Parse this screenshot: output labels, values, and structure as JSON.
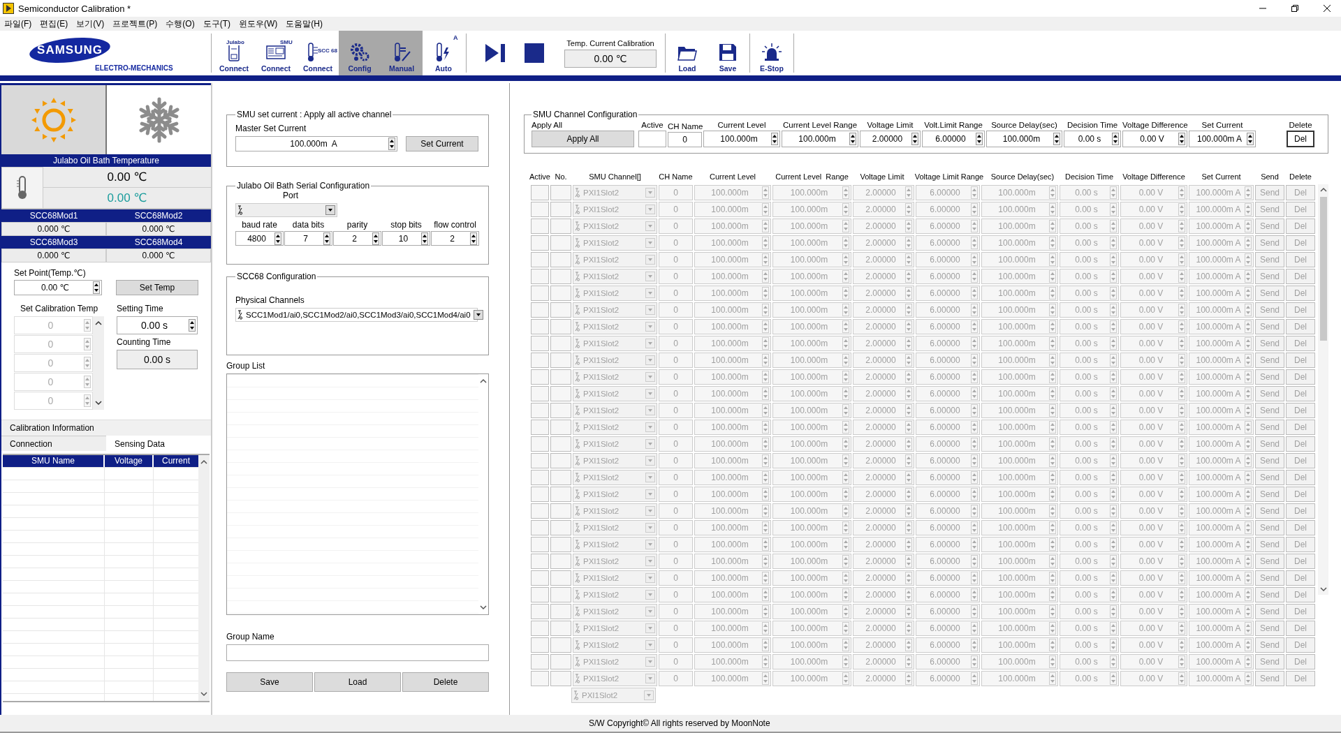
{
  "window": {
    "title": "Semiconductor Calibration *"
  },
  "menu": [
    "파일(F)",
    "편집(E)",
    "보기(V)",
    "프로젝트(P)",
    "수행(O)",
    "도구(T)",
    "윈도우(W)",
    "도움말(H)"
  ],
  "logo": {
    "brand": "SAMSUNG",
    "sub": "ELECTRO-MECHANICS"
  },
  "toolbar": [
    {
      "kind": "julabo",
      "label": "Connect",
      "icon_text": "Julabo",
      "selected": false
    },
    {
      "kind": "smu",
      "label": "Connect",
      "icon_text": "SMU",
      "selected": false
    },
    {
      "kind": "scc",
      "label": "Connect",
      "icon_text": "SCC 68",
      "selected": false
    },
    {
      "kind": "config",
      "label": "Config",
      "selected": true
    },
    {
      "kind": "manual",
      "label": "Manual",
      "selected": true
    },
    {
      "kind": "auto",
      "label": "Auto",
      "icon_text": "A",
      "selected": false
    }
  ],
  "temp_calibration": {
    "label": "Temp. Current Calibration",
    "value": "0.00 ℃"
  },
  "file_buttons": [
    {
      "kind": "load",
      "label": "Load"
    },
    {
      "kind": "save",
      "label": "Save"
    },
    {
      "kind": "estop",
      "label": "E-Stop"
    }
  ],
  "mode_buttons": [
    {
      "kind": "heat",
      "selected": true
    },
    {
      "kind": "cool",
      "selected": false
    }
  ],
  "bath": {
    "title": "Julabo Oil Bath Temperature",
    "value": "0.00 ℃",
    "setpoint": "0.00 ℃"
  },
  "modules": [
    {
      "name": "SCC68Mod1",
      "value": "0.000 ℃"
    },
    {
      "name": "SCC68Mod2",
      "value": "0.000 ℃"
    },
    {
      "name": "SCC68Mod3",
      "value": "0.000 ℃"
    },
    {
      "name": "SCC68Mod4",
      "value": "0.000 ℃"
    }
  ],
  "set_point": {
    "label": "Set Point(Temp.℃)",
    "value": "0.00 ℃",
    "button": "Set Temp"
  },
  "calibration_temps": {
    "label": "Set Calibration Temp",
    "values": [
      "0",
      "0",
      "0",
      "0",
      "0"
    ]
  },
  "setting_time": {
    "label": "Setting Time",
    "value": "0.00 s"
  },
  "counting_time": {
    "label": "Counting Time",
    "value": "0.00 s"
  },
  "info_tabs": {
    "title": "Calibration Information",
    "tabs": [
      {
        "label": "Connection",
        "selected": false
      },
      {
        "label": "Sensing Data",
        "selected": true
      }
    ]
  },
  "sensing_table": {
    "columns": [
      "SMU Name",
      "Voltage",
      "Current"
    ]
  },
  "smu_set_current": {
    "title": "SMU set current : Apply all active channel",
    "label": "Master Set Current",
    "value": "100.000m  A",
    "button": "Set Current"
  },
  "serial_config": {
    "title": "Julabo Oil Bath Serial Configuration",
    "port_label": "Port",
    "fields": [
      {
        "label": "baud rate",
        "value": "4800"
      },
      {
        "label": "data bits",
        "value": "7"
      },
      {
        "label": "parity",
        "value": "2"
      },
      {
        "label": "stop bits",
        "value": "10"
      },
      {
        "label": "flow control",
        "value": "2"
      }
    ]
  },
  "scc68": {
    "title": "SCC68 Configuration",
    "label": "Physical Channels",
    "value": "SCC1Mod1/ai0,SCC1Mod2/ai0,SCC1Mod3/ai0,SCC1Mod4/ai0"
  },
  "group_list": {
    "label": "Group List"
  },
  "group_name": {
    "label": "Group Name"
  },
  "group_buttons": [
    "Save",
    "Load",
    "Delete"
  ],
  "channel_config": {
    "title": "SMU Channel Configuration",
    "apply_label": "Apply All",
    "apply_button": "Apply All",
    "fields": [
      {
        "kind": "check",
        "label": "Active",
        "checked": false
      },
      {
        "kind": "text",
        "label": "CH Name",
        "value": "0"
      },
      {
        "kind": "spin",
        "label": "Current Level",
        "value": "100.000m"
      },
      {
        "kind": "spin",
        "label": "Current Level Range",
        "value": "100.000m"
      },
      {
        "kind": "spin",
        "label": "Voltage Limit",
        "value": "2.00000"
      },
      {
        "kind": "spin",
        "label": "Volt.Limit Range",
        "value": "6.00000"
      },
      {
        "kind": "spin",
        "label": "Source Delay(sec)",
        "value": "100.000m"
      },
      {
        "kind": "spin",
        "label": "Decision Time",
        "value": "0.00 s"
      },
      {
        "kind": "spin",
        "label": "Voltage Difference",
        "value": "0.00 V"
      },
      {
        "kind": "spin",
        "label": "Set Current",
        "value": "100.000m A"
      }
    ],
    "delete_label": "Delete",
    "delete_button": "Del"
  },
  "channels": {
    "columns": [
      "Active",
      "No.",
      "SMU Channel[]",
      "CH Name",
      "Current Level",
      "Current Level  Range",
      "Voltage Limit",
      "Voltage Limit Range",
      "Source Delay(sec)",
      "Decision Time",
      "Voltage Difference",
      "Set Current",
      "Send",
      "Delete"
    ],
    "rows": [
      {
        "active": false,
        "disabled": true,
        "channel": "PXI1Slot2",
        "ch_name": "0",
        "current_level": "100.000m",
        "range": "100.000m",
        "voltage_limit": "2.00000",
        "vlimit_range": "6.00000",
        "source_delay": "100.000m",
        "decision_time": "0.00 s",
        "voltage_difference": "0.00 V",
        "set_current": "100.000m A",
        "send": "Send",
        "delete": "Del"
      },
      {
        "active": false,
        "disabled": true,
        "channel": "PXI1Slot2",
        "ch_name": "0",
        "current_level": "100.000m",
        "range": "100.000m",
        "voltage_limit": "2.00000",
        "vlimit_range": "6.00000",
        "source_delay": "100.000m",
        "decision_time": "0.00 s",
        "voltage_difference": "0.00 V",
        "set_current": "100.000m A",
        "send": "Send",
        "delete": "Del"
      },
      {
        "active": false,
        "disabled": true,
        "channel": "PXI1Slot2",
        "ch_name": "0",
        "current_level": "100.000m",
        "range": "100.000m",
        "voltage_limit": "2.00000",
        "vlimit_range": "6.00000",
        "source_delay": "100.000m",
        "decision_time": "0.00 s",
        "voltage_difference": "0.00 V",
        "set_current": "100.000m A",
        "send": "Send",
        "delete": "Del"
      },
      {
        "active": false,
        "disabled": true,
        "channel": "PXI1Slot2",
        "ch_name": "0",
        "current_level": "100.000m",
        "range": "100.000m",
        "voltage_limit": "2.00000",
        "vlimit_range": "6.00000",
        "source_delay": "100.000m",
        "decision_time": "0.00 s",
        "voltage_difference": "0.00 V",
        "set_current": "100.000m A",
        "send": "Send",
        "delete": "Del"
      },
      {
        "active": false,
        "disabled": true,
        "channel": "PXI1Slot2",
        "ch_name": "0",
        "current_level": "100.000m",
        "range": "100.000m",
        "voltage_limit": "2.00000",
        "vlimit_range": "6.00000",
        "source_delay": "100.000m",
        "decision_time": "0.00 s",
        "voltage_difference": "0.00 V",
        "set_current": "100.000m A",
        "send": "Send",
        "delete": "Del"
      },
      {
        "active": false,
        "disabled": true,
        "channel": "PXI1Slot2",
        "ch_name": "0",
        "current_level": "100.000m",
        "range": "100.000m",
        "voltage_limit": "2.00000",
        "vlimit_range": "6.00000",
        "source_delay": "100.000m",
        "decision_time": "0.00 s",
        "voltage_difference": "0.00 V",
        "set_current": "100.000m A",
        "send": "Send",
        "delete": "Del"
      },
      {
        "active": false,
        "disabled": true,
        "channel": "PXI1Slot2",
        "ch_name": "0",
        "current_level": "100.000m",
        "range": "100.000m",
        "voltage_limit": "2.00000",
        "vlimit_range": "6.00000",
        "source_delay": "100.000m",
        "decision_time": "0.00 s",
        "voltage_difference": "0.00 V",
        "set_current": "100.000m A",
        "send": "Send",
        "delete": "Del"
      },
      {
        "active": false,
        "disabled": true,
        "channel": "PXI1Slot2",
        "ch_name": "0",
        "current_level": "100.000m",
        "range": "100.000m",
        "voltage_limit": "2.00000",
        "vlimit_range": "6.00000",
        "source_delay": "100.000m",
        "decision_time": "0.00 s",
        "voltage_difference": "0.00 V",
        "set_current": "100.000m A",
        "send": "Send",
        "delete": "Del"
      },
      {
        "active": false,
        "disabled": true,
        "channel": "PXI1Slot2",
        "ch_name": "0",
        "current_level": "100.000m",
        "range": "100.000m",
        "voltage_limit": "2.00000",
        "vlimit_range": "6.00000",
        "source_delay": "100.000m",
        "decision_time": "0.00 s",
        "voltage_difference": "0.00 V",
        "set_current": "100.000m A",
        "send": "Send",
        "delete": "Del"
      },
      {
        "active": false,
        "disabled": true,
        "channel": "PXI1Slot2",
        "ch_name": "0",
        "current_level": "100.000m",
        "range": "100.000m",
        "voltage_limit": "2.00000",
        "vlimit_range": "6.00000",
        "source_delay": "100.000m",
        "decision_time": "0.00 s",
        "voltage_difference": "0.00 V",
        "set_current": "100.000m A",
        "send": "Send",
        "delete": "Del"
      },
      {
        "active": false,
        "disabled": true,
        "channel": "PXI1Slot2",
        "ch_name": "0",
        "current_level": "100.000m",
        "range": "100.000m",
        "voltage_limit": "2.00000",
        "vlimit_range": "6.00000",
        "source_delay": "100.000m",
        "decision_time": "0.00 s",
        "voltage_difference": "0.00 V",
        "set_current": "100.000m A",
        "send": "Send",
        "delete": "Del"
      },
      {
        "active": false,
        "disabled": true,
        "channel": "PXI1Slot2",
        "ch_name": "0",
        "current_level": "100.000m",
        "range": "100.000m",
        "voltage_limit": "2.00000",
        "vlimit_range": "6.00000",
        "source_delay": "100.000m",
        "decision_time": "0.00 s",
        "voltage_difference": "0.00 V",
        "set_current": "100.000m A",
        "send": "Send",
        "delete": "Del"
      },
      {
        "active": false,
        "disabled": true,
        "channel": "PXI1Slot2",
        "ch_name": "0",
        "current_level": "100.000m",
        "range": "100.000m",
        "voltage_limit": "2.00000",
        "vlimit_range": "6.00000",
        "source_delay": "100.000m",
        "decision_time": "0.00 s",
        "voltage_difference": "0.00 V",
        "set_current": "100.000m A",
        "send": "Send",
        "delete": "Del"
      },
      {
        "active": false,
        "disabled": true,
        "channel": "PXI1Slot2",
        "ch_name": "0",
        "current_level": "100.000m",
        "range": "100.000m",
        "voltage_limit": "2.00000",
        "vlimit_range": "6.00000",
        "source_delay": "100.000m",
        "decision_time": "0.00 s",
        "voltage_difference": "0.00 V",
        "set_current": "100.000m A",
        "send": "Send",
        "delete": "Del"
      },
      {
        "active": false,
        "disabled": true,
        "channel": "PXI1Slot2",
        "ch_name": "0",
        "current_level": "100.000m",
        "range": "100.000m",
        "voltage_limit": "2.00000",
        "vlimit_range": "6.00000",
        "source_delay": "100.000m",
        "decision_time": "0.00 s",
        "voltage_difference": "0.00 V",
        "set_current": "100.000m A",
        "send": "Send",
        "delete": "Del"
      },
      {
        "active": false,
        "disabled": true,
        "channel": "PXI1Slot2",
        "ch_name": "0",
        "current_level": "100.000m",
        "range": "100.000m",
        "voltage_limit": "2.00000",
        "vlimit_range": "6.00000",
        "source_delay": "100.000m",
        "decision_time": "0.00 s",
        "voltage_difference": "0.00 V",
        "set_current": "100.000m A",
        "send": "Send",
        "delete": "Del"
      },
      {
        "active": false,
        "disabled": true,
        "channel": "PXI1Slot2",
        "ch_name": "0",
        "current_level": "100.000m",
        "range": "100.000m",
        "voltage_limit": "2.00000",
        "vlimit_range": "6.00000",
        "source_delay": "100.000m",
        "decision_time": "0.00 s",
        "voltage_difference": "0.00 V",
        "set_current": "100.000m A",
        "send": "Send",
        "delete": "Del"
      },
      {
        "active": false,
        "disabled": true,
        "channel": "PXI1Slot2",
        "ch_name": "0",
        "current_level": "100.000m",
        "range": "100.000m",
        "voltage_limit": "2.00000",
        "vlimit_range": "6.00000",
        "source_delay": "100.000m",
        "decision_time": "0.00 s",
        "voltage_difference": "0.00 V",
        "set_current": "100.000m A",
        "send": "Send",
        "delete": "Del"
      },
      {
        "active": false,
        "disabled": true,
        "channel": "PXI1Slot2",
        "ch_name": "0",
        "current_level": "100.000m",
        "range": "100.000m",
        "voltage_limit": "2.00000",
        "vlimit_range": "6.00000",
        "source_delay": "100.000m",
        "decision_time": "0.00 s",
        "voltage_difference": "0.00 V",
        "set_current": "100.000m A",
        "send": "Send",
        "delete": "Del"
      },
      {
        "active": false,
        "disabled": true,
        "channel": "PXI1Slot2",
        "ch_name": "0",
        "current_level": "100.000m",
        "range": "100.000m",
        "voltage_limit": "2.00000",
        "vlimit_range": "6.00000",
        "source_delay": "100.000m",
        "decision_time": "0.00 s",
        "voltage_difference": "0.00 V",
        "set_current": "100.000m A",
        "send": "Send",
        "delete": "Del"
      },
      {
        "active": false,
        "disabled": true,
        "channel": "PXI1Slot2",
        "ch_name": "0",
        "current_level": "100.000m",
        "range": "100.000m",
        "voltage_limit": "2.00000",
        "vlimit_range": "6.00000",
        "source_delay": "100.000m",
        "decision_time": "0.00 s",
        "voltage_difference": "0.00 V",
        "set_current": "100.000m A",
        "send": "Send",
        "delete": "Del"
      },
      {
        "active": false,
        "disabled": true,
        "channel": "PXI1Slot2",
        "ch_name": "0",
        "current_level": "100.000m",
        "range": "100.000m",
        "voltage_limit": "2.00000",
        "vlimit_range": "6.00000",
        "source_delay": "100.000m",
        "decision_time": "0.00 s",
        "voltage_difference": "0.00 V",
        "set_current": "100.000m A",
        "send": "Send",
        "delete": "Del"
      },
      {
        "active": false,
        "disabled": true,
        "channel": "PXI1Slot2",
        "ch_name": "0",
        "current_level": "100.000m",
        "range": "100.000m",
        "voltage_limit": "2.00000",
        "vlimit_range": "6.00000",
        "source_delay": "100.000m",
        "decision_time": "0.00 s",
        "voltage_difference": "0.00 V",
        "set_current": "100.000m A",
        "send": "Send",
        "delete": "Del"
      },
      {
        "active": false,
        "disabled": true,
        "channel": "PXI1Slot2",
        "ch_name": "0",
        "current_level": "100.000m",
        "range": "100.000m",
        "voltage_limit": "2.00000",
        "vlimit_range": "6.00000",
        "source_delay": "100.000m",
        "decision_time": "0.00 s",
        "voltage_difference": "0.00 V",
        "set_current": "100.000m A",
        "send": "Send",
        "delete": "Del"
      },
      {
        "active": false,
        "disabled": true,
        "channel": "PXI1Slot2",
        "ch_name": "0",
        "current_level": "100.000m",
        "range": "100.000m",
        "voltage_limit": "2.00000",
        "vlimit_range": "6.00000",
        "source_delay": "100.000m",
        "decision_time": "0.00 s",
        "voltage_difference": "0.00 V",
        "set_current": "100.000m A",
        "send": "Send",
        "delete": "Del"
      },
      {
        "active": false,
        "disabled": true,
        "channel": "PXI1Slot2",
        "ch_name": "0",
        "current_level": "100.000m",
        "range": "100.000m",
        "voltage_limit": "2.00000",
        "vlimit_range": "6.00000",
        "source_delay": "100.000m",
        "decision_time": "0.00 s",
        "voltage_difference": "0.00 V",
        "set_current": "100.000m A",
        "send": "Send",
        "delete": "Del"
      },
      {
        "active": false,
        "disabled": true,
        "channel": "PXI1Slot2",
        "ch_name": "0",
        "current_level": "100.000m",
        "range": "100.000m",
        "voltage_limit": "2.00000",
        "vlimit_range": "6.00000",
        "source_delay": "100.000m",
        "decision_time": "0.00 s",
        "voltage_difference": "0.00 V",
        "set_current": "100.000m A",
        "send": "Send",
        "delete": "Del"
      },
      {
        "active": false,
        "disabled": true,
        "channel": "PXI1Slot2",
        "ch_name": "0",
        "current_level": "100.000m",
        "range": "100.000m",
        "voltage_limit": "2.00000",
        "vlimit_range": "6.00000",
        "source_delay": "100.000m",
        "decision_time": "0.00 s",
        "voltage_difference": "0.00 V",
        "set_current": "100.000m A",
        "send": "Send",
        "delete": "Del"
      },
      {
        "active": false,
        "disabled": true,
        "channel": "PXI1Slot2",
        "ch_name": "0",
        "current_level": "100.000m",
        "range": "100.000m",
        "voltage_limit": "2.00000",
        "vlimit_range": "6.00000",
        "source_delay": "100.000m",
        "decision_time": "0.00 s",
        "voltage_difference": "0.00 V",
        "set_current": "100.000m A",
        "send": "Send",
        "delete": "Del"
      },
      {
        "active": false,
        "disabled": true,
        "channel": "PXI1Slot2",
        "ch_name": "0",
        "current_level": "100.000m",
        "range": "100.000m",
        "voltage_limit": "2.00000",
        "vlimit_range": "6.00000",
        "source_delay": "100.000m",
        "decision_time": "0.00 s",
        "voltage_difference": "0.00 V",
        "set_current": "100.000m A",
        "send": "Send",
        "delete": "Del"
      }
    ],
    "extra_channel": "PXI1Slot2"
  },
  "footer": "S/W Copyright© All rights reserved by MoonNote"
}
